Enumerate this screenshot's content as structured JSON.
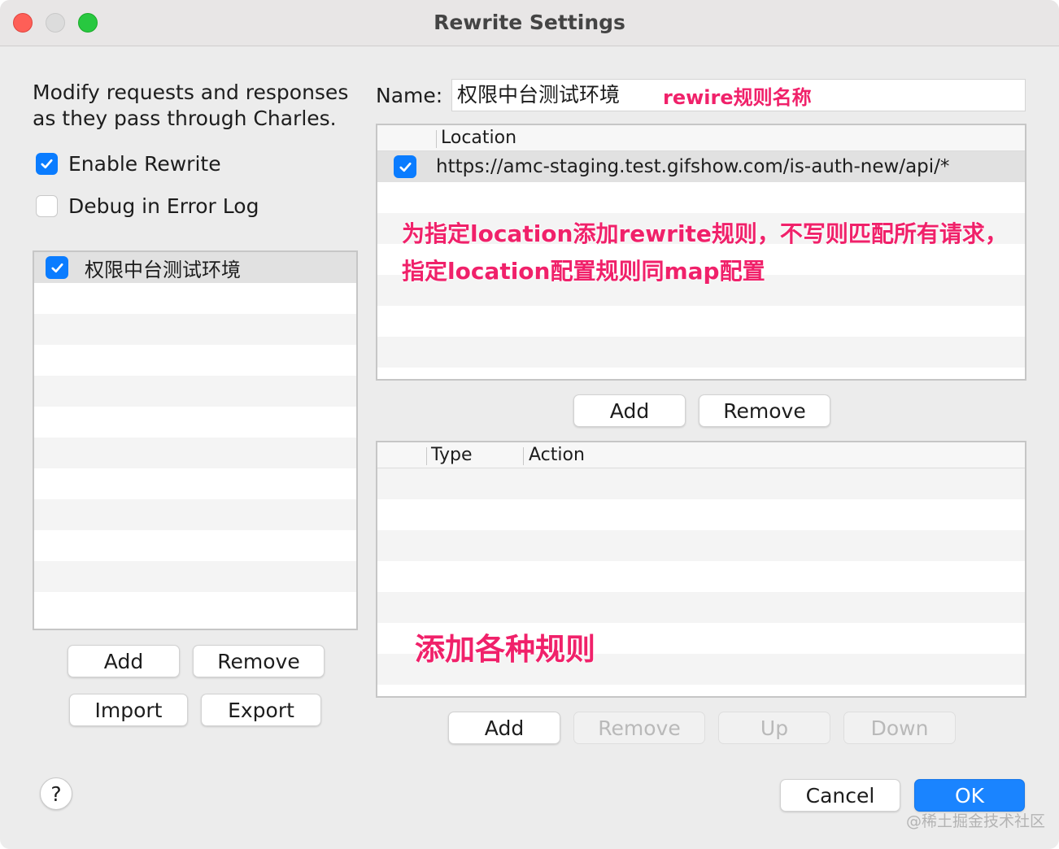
{
  "window": {
    "title": "Rewrite Settings"
  },
  "sidebar": {
    "description": "Modify requests and responses as they pass through Charles.",
    "enable_rewrite": {
      "label": "Enable Rewrite",
      "checked": true
    },
    "debug_error_log": {
      "label": "Debug in Error Log",
      "checked": false
    },
    "rules": [
      {
        "name": "权限中台测试环境",
        "checked": true
      }
    ],
    "add_label": "Add",
    "remove_label": "Remove",
    "import_label": "Import",
    "export_label": "Export"
  },
  "name_field": {
    "label": "Name:",
    "value": "权限中台测试环境"
  },
  "locations": {
    "header": "Location",
    "rows": [
      {
        "url": "https://amc-staging.test.gifshow.com/is-auth-new/api/*",
        "checked": true
      }
    ],
    "add_label": "Add",
    "remove_label": "Remove"
  },
  "rules_table": {
    "headers": {
      "type": "Type",
      "action": "Action"
    },
    "rows": [],
    "add_label": "Add",
    "remove_label": "Remove",
    "up_label": "Up",
    "down_label": "Down"
  },
  "footer": {
    "help_label": "?",
    "cancel_label": "Cancel",
    "ok_label": "OK"
  },
  "annotations": {
    "name_note": "rewire规则名称",
    "location_note_line1": "为指定location添加rewrite规则，不写则匹配所有请求，",
    "location_note_line2": "指定location配置规则同map配置",
    "rules_note": "添加各种规则"
  },
  "watermark": "@稀土掘金技术社区",
  "colors": {
    "accent": "#0a7cff",
    "annotation": "#f0216a",
    "primary_button": "#1a84ff"
  }
}
